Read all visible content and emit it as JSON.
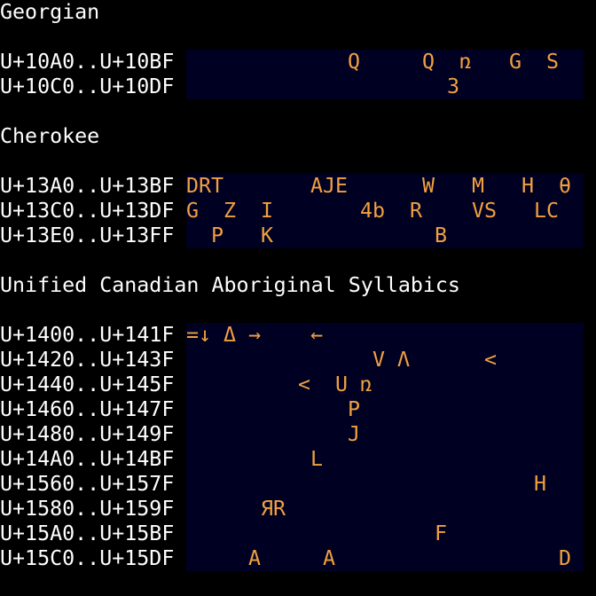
{
  "colors": {
    "background": "#000000",
    "cell_background": "#000022",
    "label_text": "#ffffff",
    "glyph_text": "#f0a040"
  },
  "blocks": [
    {
      "title": "Georgian",
      "rows": [
        {
          "range": "U+10A0..U+10BF",
          "glyphs": [
            {
              "col": 13,
              "char": "Q"
            },
            {
              "col": 19,
              "char": "Q"
            },
            {
              "col": 22,
              "char": "ռ"
            },
            {
              "col": 26,
              "char": "G"
            },
            {
              "col": 29,
              "char": "S"
            }
          ]
        },
        {
          "range": "U+10C0..U+10DF",
          "glyphs": [
            {
              "col": 21,
              "char": "3"
            }
          ]
        }
      ]
    },
    {
      "title": "Cherokee",
      "rows": [
        {
          "range": "U+13A0..U+13BF",
          "glyphs": [
            {
              "col": 0,
              "char": "D"
            },
            {
              "col": 1,
              "char": "R"
            },
            {
              "col": 2,
              "char": "T"
            },
            {
              "col": 10,
              "char": "A"
            },
            {
              "col": 11,
              "char": "J"
            },
            {
              "col": 12,
              "char": "E"
            },
            {
              "col": 19,
              "char": "W"
            },
            {
              "col": 23,
              "char": "M"
            },
            {
              "col": 27,
              "char": "H"
            },
            {
              "col": 30,
              "char": "θ"
            }
          ]
        },
        {
          "range": "U+13C0..U+13DF",
          "glyphs": [
            {
              "col": 0,
              "char": "G"
            },
            {
              "col": 3,
              "char": "Z"
            },
            {
              "col": 6,
              "char": "I"
            },
            {
              "col": 14,
              "char": "4"
            },
            {
              "col": 15,
              "char": "b"
            },
            {
              "col": 18,
              "char": "R"
            },
            {
              "col": 23,
              "char": "V"
            },
            {
              "col": 24,
              "char": "S"
            },
            {
              "col": 28,
              "char": "L"
            },
            {
              "col": 29,
              "char": "C"
            }
          ]
        },
        {
          "range": "U+13E0..U+13FF",
          "glyphs": [
            {
              "col": 2,
              "char": "P"
            },
            {
              "col": 6,
              "char": "K"
            },
            {
              "col": 20,
              "char": "B"
            }
          ]
        }
      ]
    },
    {
      "title": "Unified Canadian Aboriginal Syllabics",
      "rows": [
        {
          "range": "U+1400..U+141F",
          "glyphs": [
            {
              "col": 0,
              "char": "="
            },
            {
              "col": 1,
              "char": "↓"
            },
            {
              "col": 3,
              "char": "Δ"
            },
            {
              "col": 5,
              "char": "→"
            },
            {
              "col": 10,
              "char": "←"
            }
          ]
        },
        {
          "range": "U+1420..U+143F",
          "glyphs": [
            {
              "col": 15,
              "char": "V"
            },
            {
              "col": 17,
              "char": "Λ"
            },
            {
              "col": 24,
              "char": "<"
            }
          ]
        },
        {
          "range": "U+1440..U+145F",
          "glyphs": [
            {
              "col": 9,
              "char": "<"
            },
            {
              "col": 12,
              "char": "U"
            },
            {
              "col": 14,
              "char": "ռ"
            }
          ]
        },
        {
          "range": "U+1460..U+147F",
          "glyphs": [
            {
              "col": 13,
              "char": "P"
            }
          ]
        },
        {
          "range": "U+1480..U+149F",
          "glyphs": [
            {
              "col": 13,
              "char": "J"
            }
          ]
        },
        {
          "range": "U+14A0..U+14BF",
          "glyphs": [
            {
              "col": 10,
              "char": "L"
            }
          ]
        },
        {
          "range": "U+1560..U+157F",
          "glyphs": [
            {
              "col": 28,
              "char": "H"
            }
          ]
        },
        {
          "range": "U+1580..U+159F",
          "glyphs": [
            {
              "col": 6,
              "char": "Я"
            },
            {
              "col": 7,
              "char": "R"
            }
          ]
        },
        {
          "range": "U+15A0..U+15BF",
          "glyphs": [
            {
              "col": 20,
              "char": "F"
            }
          ]
        },
        {
          "range": "U+15C0..U+15DF",
          "glyphs": [
            {
              "col": 5,
              "char": "A"
            },
            {
              "col": 11,
              "char": "A"
            },
            {
              "col": 30,
              "char": "D"
            }
          ]
        }
      ]
    }
  ]
}
